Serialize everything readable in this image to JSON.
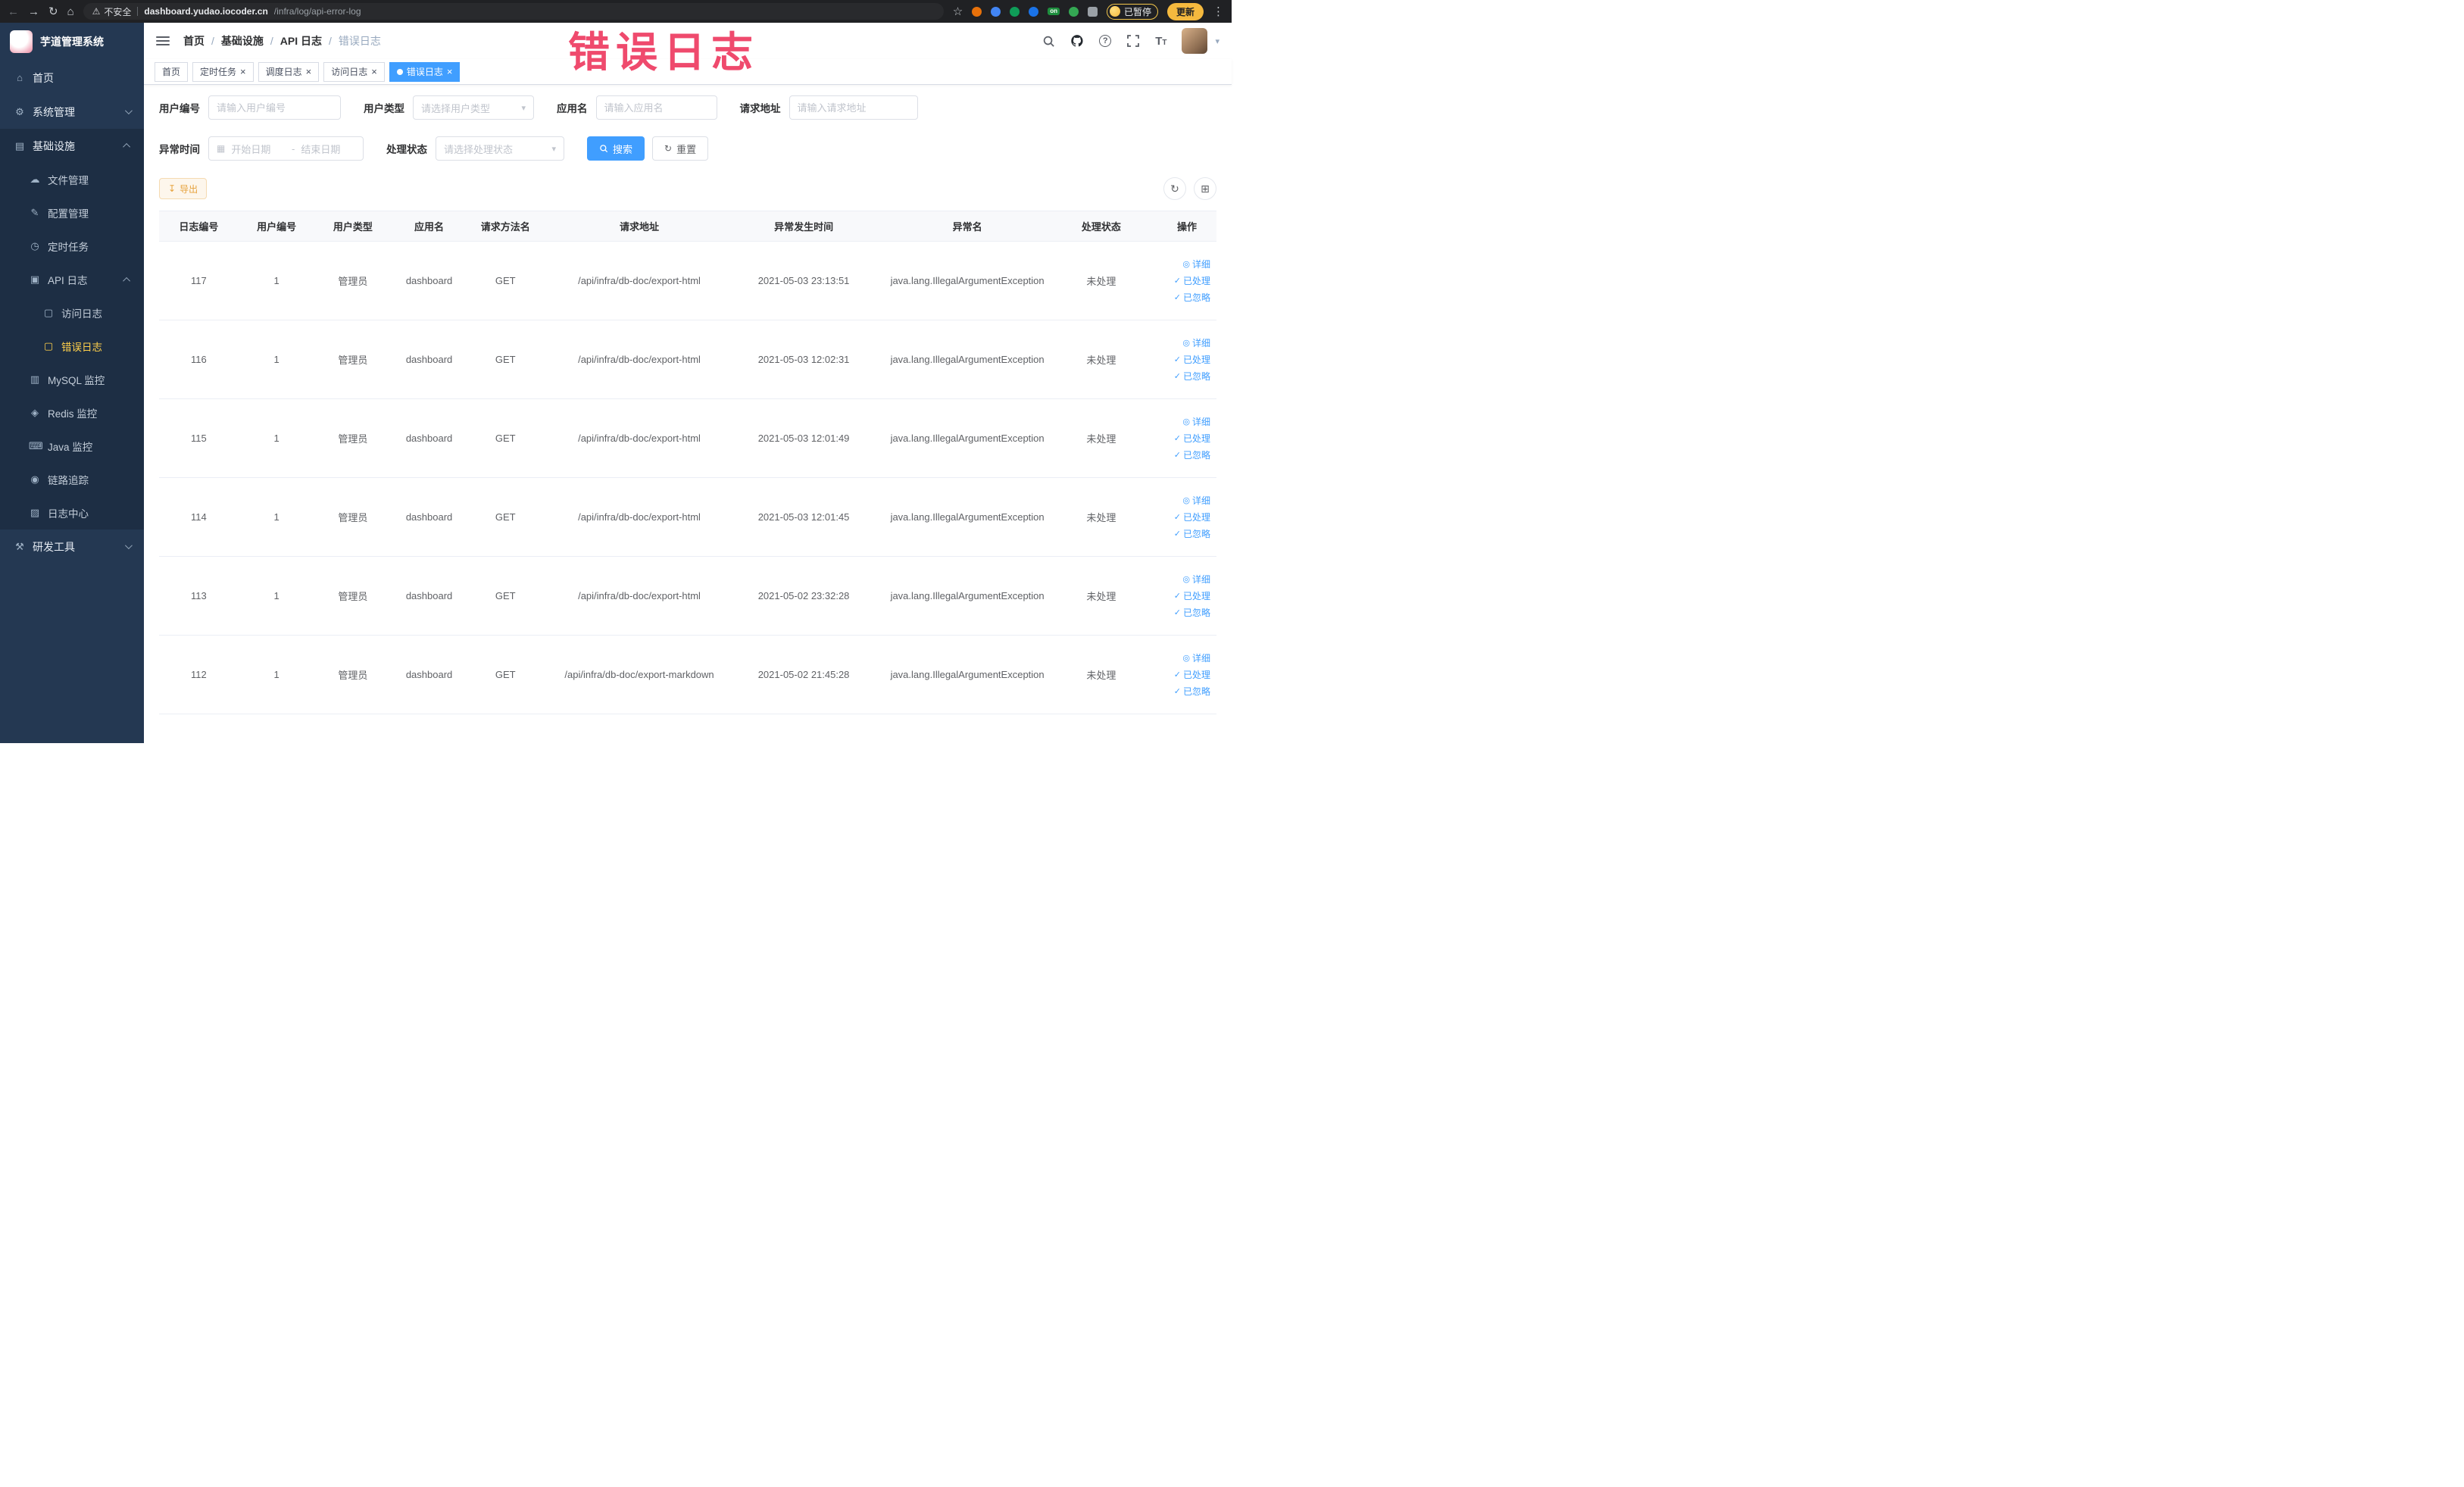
{
  "browser": {
    "security": "不安全",
    "url_domain": "dashboard.yudao.iocoder.cn",
    "url_path": "/infra/log/api-error-log",
    "on_badge": "on",
    "paused_badge": "已暂停",
    "update_button": "更新"
  },
  "watermark": "错误日志",
  "sidebar": {
    "title": "芋道管理系统",
    "home": "首页",
    "system": "系统管理",
    "infra": "基础设施",
    "file": "文件管理",
    "config": "配置管理",
    "job": "定时任务",
    "api_log": "API 日志",
    "access_log": "访问日志",
    "error_log": "错误日志",
    "mysql": "MySQL 监控",
    "redis": "Redis 监控",
    "java": "Java 监控",
    "trace": "链路追踪",
    "log_center": "日志中心",
    "dev_tools": "研发工具"
  },
  "navbar": {
    "breadcrumb": [
      "首页",
      "基础设施",
      "API 日志",
      "错误日志"
    ]
  },
  "tabs": [
    {
      "label": "首页",
      "closable": false,
      "active": false
    },
    {
      "label": "定时任务",
      "closable": true,
      "active": false
    },
    {
      "label": "调度日志",
      "closable": true,
      "active": false
    },
    {
      "label": "访问日志",
      "closable": true,
      "active": false
    },
    {
      "label": "错误日志",
      "closable": true,
      "active": true
    }
  ],
  "filters": {
    "user_id_label": "用户编号",
    "user_id_placeholder": "请输入用户编号",
    "user_type_label": "用户类型",
    "user_type_placeholder": "请选择用户类型",
    "app_name_label": "应用名",
    "app_name_placeholder": "请输入应用名",
    "request_url_label": "请求地址",
    "request_url_placeholder": "请输入请求地址",
    "exception_time_label": "异常时间",
    "date_start_placeholder": "开始日期",
    "date_separator": "-",
    "date_end_placeholder": "结束日期",
    "process_status_label": "处理状态",
    "process_status_placeholder": "请选择处理状态",
    "search_button": "搜索",
    "reset_button": "重置"
  },
  "toolbar": {
    "export_button": "导出"
  },
  "table": {
    "headers": [
      "日志编号",
      "用户编号",
      "用户类型",
      "应用名",
      "请求方法名",
      "请求地址",
      "异常发生时间",
      "异常名",
      "处理状态",
      "操作"
    ],
    "row_actions": {
      "detail": "详细",
      "processed": "已处理",
      "ignored": "已忽略"
    },
    "rows": [
      {
        "id": "117",
        "user_id": "1",
        "user_type": "管理员",
        "app": "dashboard",
        "method": "GET",
        "url": "/api/infra/db-doc/export-html",
        "time": "2021-05-03 23:13:51",
        "exception": "java.lang.IllegalArgumentException",
        "status": "未处理"
      },
      {
        "id": "116",
        "user_id": "1",
        "user_type": "管理员",
        "app": "dashboard",
        "method": "GET",
        "url": "/api/infra/db-doc/export-html",
        "time": "2021-05-03 12:02:31",
        "exception": "java.lang.IllegalArgumentException",
        "status": "未处理"
      },
      {
        "id": "115",
        "user_id": "1",
        "user_type": "管理员",
        "app": "dashboard",
        "method": "GET",
        "url": "/api/infra/db-doc/export-html",
        "time": "2021-05-03 12:01:49",
        "exception": "java.lang.IllegalArgumentException",
        "status": "未处理"
      },
      {
        "id": "114",
        "user_id": "1",
        "user_type": "管理员",
        "app": "dashboard",
        "method": "GET",
        "url": "/api/infra/db-doc/export-html",
        "time": "2021-05-03 12:01:45",
        "exception": "java.lang.IllegalArgumentException",
        "status": "未处理"
      },
      {
        "id": "113",
        "user_id": "1",
        "user_type": "管理员",
        "app": "dashboard",
        "method": "GET",
        "url": "/api/infra/db-doc/export-html",
        "time": "2021-05-02 23:32:28",
        "exception": "java.lang.IllegalArgumentException",
        "status": "未处理"
      },
      {
        "id": "112",
        "user_id": "1",
        "user_type": "管理员",
        "app": "dashboard",
        "method": "GET",
        "url": "/api/infra/db-doc/export-markdown",
        "time": "2021-05-02 21:45:28",
        "exception": "java.lang.IllegalArgumentException",
        "status": "未处理"
      }
    ]
  },
  "icons": {
    "close": "×",
    "back": "←",
    "forward": "→",
    "reload": "↻",
    "home": "⌂",
    "warning": "⚠",
    "star": "☆",
    "more": "⋮",
    "caret": "▾",
    "check": "✓",
    "eye": "◎",
    "download": "↧",
    "calendar": "▦",
    "refresh": "↻",
    "columns": "⊞",
    "question": "?",
    "font_size": "T",
    "menu_home": "⌂",
    "menu_system": "⚙",
    "menu_infra": "▤",
    "menu_file": "☁",
    "menu_config": "✎",
    "menu_job": "◷",
    "menu_api": "▣",
    "menu_doc": "▢",
    "menu_mysql": "▥",
    "menu_redis": "◈",
    "menu_java": "⌨",
    "menu_trace": "◉",
    "menu_logcenter": "▨",
    "menu_tools": "⚒"
  },
  "colors": {
    "accent": "#409eff",
    "active_menu": "#ffd04b",
    "watermark": "#ef4a6d",
    "warning": "#e6a23c",
    "sidebar_bg": "#243852",
    "chrome_bg": "#202124"
  }
}
